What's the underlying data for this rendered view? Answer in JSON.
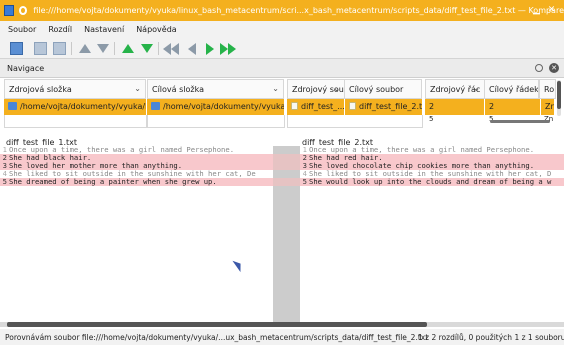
{
  "window": {
    "title": "file:///home/vojta/dokumenty/vyuka/linux_bash_metacentrum/scri...x_bash_metacentrum/scripts_data/diff_test_file_2.txt — Kompare",
    "minimize_glyph": "▁",
    "close_glyph": "✕",
    "accent_color": "#f4b01e"
  },
  "menu": {
    "items": [
      "Soubor",
      "Rozdíl",
      "Nastavení",
      "Nápověda"
    ]
  },
  "toolbar": {
    "icons": [
      "save-icon",
      "save-disk-icon",
      "save-all-icon",
      "previous-file-icon",
      "next-file-icon",
      "previous-difference-icon",
      "next-difference-icon",
      "first-difference-icon",
      "previous-icon",
      "next-icon",
      "last-icon"
    ]
  },
  "navigation": {
    "title": "Navigace",
    "columns": {
      "source_folder": "Zdrojová složka",
      "dest_folder": "Cílová složka",
      "source_file": "Zdrojový sou",
      "dest_file": "Cílový soubor",
      "source_line": "Zdrojový řác",
      "dest_line": "Cílový řádek",
      "extra": "Ro"
    },
    "selected_row": {
      "source_folder": "/home/vojta/dokumenty/vyuka/l...",
      "dest_folder": "/home/vojta/dokumenty/vyuka/l...",
      "source_file": "diff_test_...",
      "dest_file": "diff_test_file_2.txt",
      "source_line": "2",
      "dest_line": "2",
      "extra": "Zn"
    },
    "partial_row": {
      "source_line": "5",
      "dest_line": "5",
      "extra": "Zn"
    }
  },
  "left_pane": {
    "filename": "diff_test_file_1.txt",
    "lines": [
      {
        "num": "1",
        "text": "Once upon a time, there was a girl named Persephone.",
        "state": "same"
      },
      {
        "num": "2",
        "text": "She had black hair.",
        "state": "changed"
      },
      {
        "num": "3",
        "text": "She loved her mother more than anything.",
        "state": "changed"
      },
      {
        "num": "4",
        "text": "She liked to sit outside in the sunshine with her cat, De",
        "state": "same"
      },
      {
        "num": "5",
        "text": "She dreamed of being a painter when she grew up.",
        "state": "changed"
      }
    ]
  },
  "right_pane": {
    "filename": "diff_test_file_2.txt",
    "lines": [
      {
        "num": "1",
        "text": "Once upon a time, there was a girl named Persephone.",
        "state": "same"
      },
      {
        "num": "2",
        "text": "She had red hair.",
        "state": "changed"
      },
      {
        "num": "3",
        "text": "She loved chocolate chip cookies more than anything.",
        "state": "changed"
      },
      {
        "num": "4",
        "text": "She liked to sit outside in the sunshine with her cat, D",
        "state": "same"
      },
      {
        "num": "5",
        "text": "She would look up into the clouds and dream of being a w",
        "state": "changed"
      }
    ]
  },
  "status": {
    "message": "Porovnávám soubor file:///home/vojta/dokumenty/vyuka/...ux_bash_metacentrum/scripts_data/diff_test_file_2.txt",
    "counts": "1 z 2 rozdílů, 0 použitých   1 z 1 souboru"
  }
}
